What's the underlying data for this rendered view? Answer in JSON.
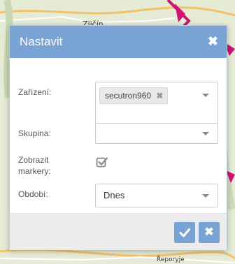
{
  "map": {
    "labels": {
      "top_town": "Zličín",
      "bottom_town": "Řeporyje"
    }
  },
  "dialog": {
    "title": "Nastavit",
    "fields": {
      "device": {
        "label": "Zařízení:",
        "selected_tag": "secutron960"
      },
      "group": {
        "label": "Skupina:",
        "value": ""
      },
      "show_markers": {
        "label": "Zobrazit markery:",
        "checked": true
      },
      "period": {
        "label": "Období:",
        "value": "Dnes"
      }
    }
  },
  "colors": {
    "accent": "#79a3d4",
    "footer_bg": "#ececec"
  },
  "icons": {
    "close": "close-icon",
    "tag_remove": "tag-remove-icon",
    "dropdown": "chevron-down-icon",
    "checkbox": "checkbox-checked-icon",
    "confirm": "check-icon",
    "cancel": "close-icon"
  }
}
